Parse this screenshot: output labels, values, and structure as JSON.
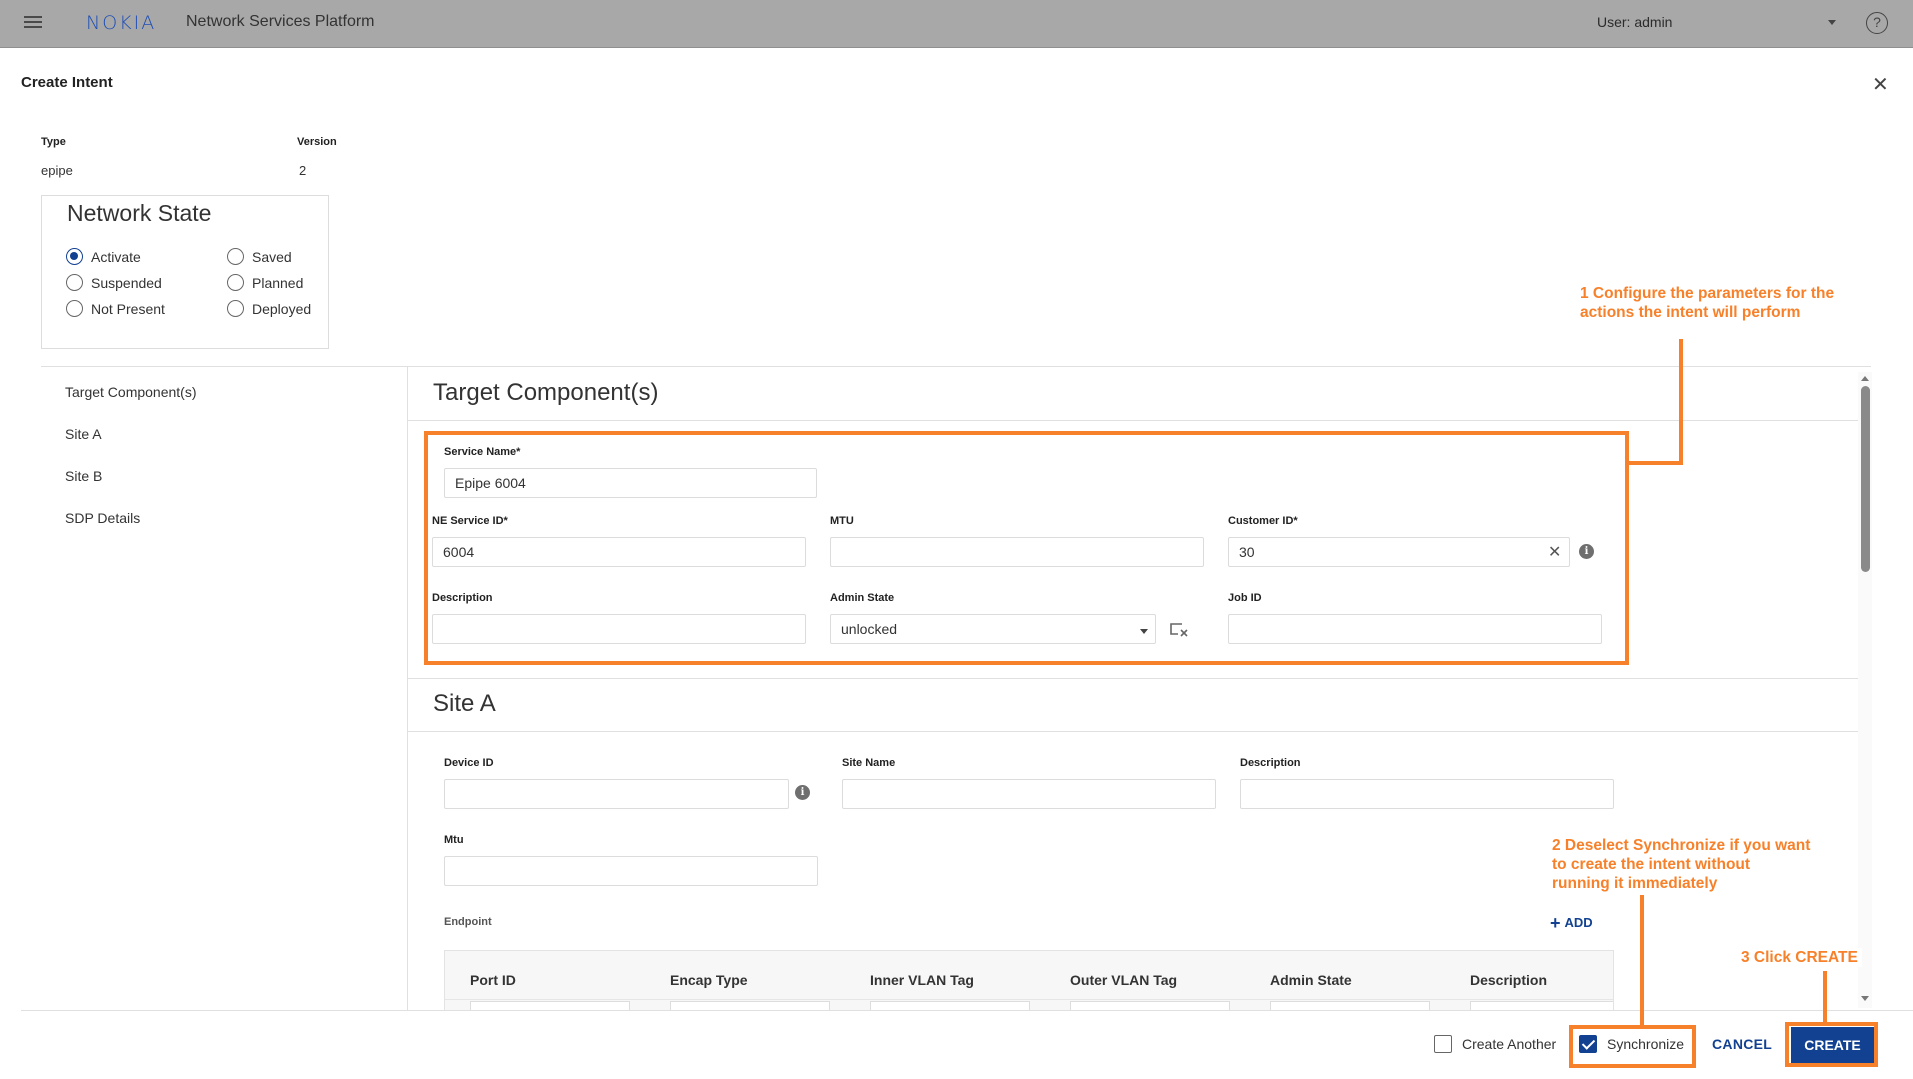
{
  "header": {
    "logo": "NOKIA",
    "app_title": "Network Services Platform",
    "user": "User: admin",
    "help": "?"
  },
  "dialog": {
    "title": "Create Intent",
    "close": "✕",
    "type_label": "Type",
    "type_value": "epipe",
    "version_label": "Version",
    "version_value": "2"
  },
  "network_state": {
    "title": "Network State",
    "selected": "Activate",
    "options": [
      "Activate",
      "Suspended",
      "Not Present",
      "Saved",
      "Planned",
      "Deployed"
    ]
  },
  "nav": {
    "items": [
      "Target Component(s)",
      "Site A",
      "Site B",
      "SDP Details"
    ]
  },
  "target": {
    "title": "Target Component(s)",
    "service_name_label": "Service Name*",
    "service_name_value": "Epipe 6004",
    "ne_service_id_label": "NE Service ID*",
    "ne_service_id_value": "6004",
    "mtu_label": "MTU",
    "mtu_value": "",
    "customer_id_label": "Customer ID*",
    "customer_id_value": "30",
    "description_label": "Description",
    "description_value": "",
    "admin_state_label": "Admin State",
    "admin_state_value": "unlocked",
    "job_id_label": "Job ID",
    "job_id_value": ""
  },
  "site_a": {
    "title": "Site A",
    "device_id_label": "Device ID",
    "site_name_label": "Site Name",
    "description_label": "Description",
    "mtu_label": "Mtu",
    "endpoint_label": "Endpoint",
    "add_label": "ADD",
    "table_headers": [
      "Port ID",
      "Encap Type",
      "Inner VLAN Tag",
      "Outer VLAN Tag",
      "Admin State",
      "Description"
    ]
  },
  "callouts": {
    "one": "1 Configure the parameters for the actions the intent will perform",
    "two": "2 Deselect Synchronize if you want to create the intent without running it immediately",
    "three": "3 Click CREATE"
  },
  "footer": {
    "create_another_label": "Create Another",
    "create_another_checked": false,
    "synchronize_label": "Synchronize",
    "synchronize_checked": true,
    "cancel_label": "CANCEL",
    "create_label": "CREATE"
  },
  "colors": {
    "brand": "#124191",
    "annotation": "#f7812a",
    "header_bg": "#a8a8a8"
  }
}
